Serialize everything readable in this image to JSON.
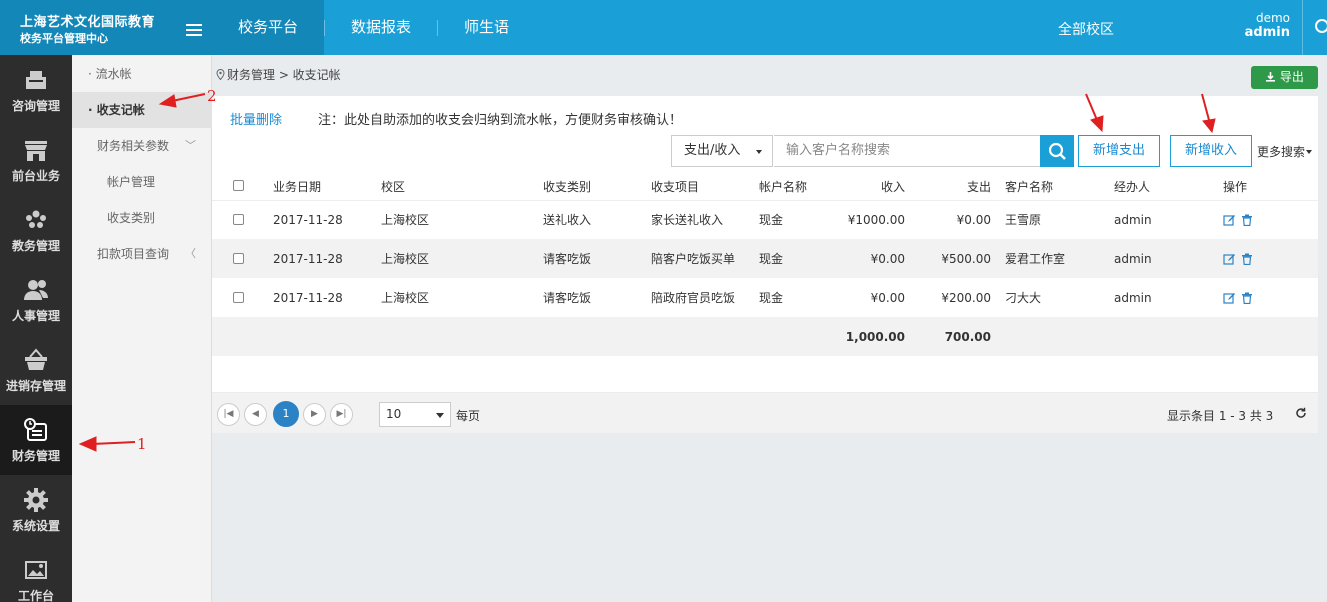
{
  "brand": {
    "line1": "上海艺术文化国际教育",
    "line2": "校务平台管理中心"
  },
  "nav": {
    "tabs": [
      "校务平台",
      "数据报表",
      "师生语"
    ],
    "active": 0
  },
  "campus": "全部校区",
  "user": {
    "name": "demo",
    "role": "admin"
  },
  "iconbar": [
    {
      "label": "咨询管理",
      "icon": "register-icon"
    },
    {
      "label": "前台业务",
      "icon": "store-icon"
    },
    {
      "label": "教务管理",
      "icon": "group-icon"
    },
    {
      "label": "人事管理",
      "icon": "users-icon"
    },
    {
      "label": "进销存管理",
      "icon": "basket-icon"
    },
    {
      "label": "财务管理",
      "icon": "finance-icon",
      "active": true
    },
    {
      "label": "系统设置",
      "icon": "gear-icon"
    },
    {
      "label": "工作台",
      "icon": "image-icon"
    }
  ],
  "subbar": [
    {
      "label": "· 流水帐"
    },
    {
      "label": "· 收支记帐",
      "active": true
    },
    {
      "label": "财务相关参数",
      "chevron": "﹀"
    },
    {
      "label": "帐户管理"
    },
    {
      "label": "收支类别"
    },
    {
      "label": "扣款项目查询",
      "chevron": "〈"
    }
  ],
  "breadcrumb": "财务管理 > 收支记帐",
  "export_label": "导出",
  "toolbar": {
    "batch_delete": "批量删除",
    "note": "注：此处自助添加的收支会归纳到流水帐，方便财务审核确认！",
    "filter_value": "支出/收入",
    "search_placeholder": "输入客户名称搜索",
    "add_expense": "新增支出",
    "add_income": "新增收入",
    "more_search": "更多搜索"
  },
  "table": {
    "headers": [
      "业务日期",
      "校区",
      "收支类别",
      "收支项目",
      "帐户名称",
      "收入",
      "支出",
      "客户名称",
      "经办人",
      "操作"
    ],
    "rows": [
      [
        "2017-11-28",
        "上海校区",
        "送礼收入",
        "家长送礼收入",
        "现金",
        "¥1000.00",
        "¥0.00",
        "王雪原",
        "admin"
      ],
      [
        "2017-11-28",
        "上海校区",
        "请客吃饭",
        "陪客户吃饭买单",
        "现金",
        "¥0.00",
        "¥500.00",
        "爱君工作室",
        "admin"
      ],
      [
        "2017-11-28",
        "上海校区",
        "请客吃饭",
        "陪政府官员吃饭",
        "现金",
        "¥0.00",
        "¥200.00",
        "刁大大",
        "admin"
      ]
    ],
    "total_income": "1,000.00",
    "total_expense": "700.00"
  },
  "pager": {
    "current_page": "1",
    "page_size": "10",
    "per_page_label": "每页",
    "showing": "显示条目 1 - 3 共 3"
  },
  "annotations": {
    "a1": "1",
    "a2": "2"
  }
}
